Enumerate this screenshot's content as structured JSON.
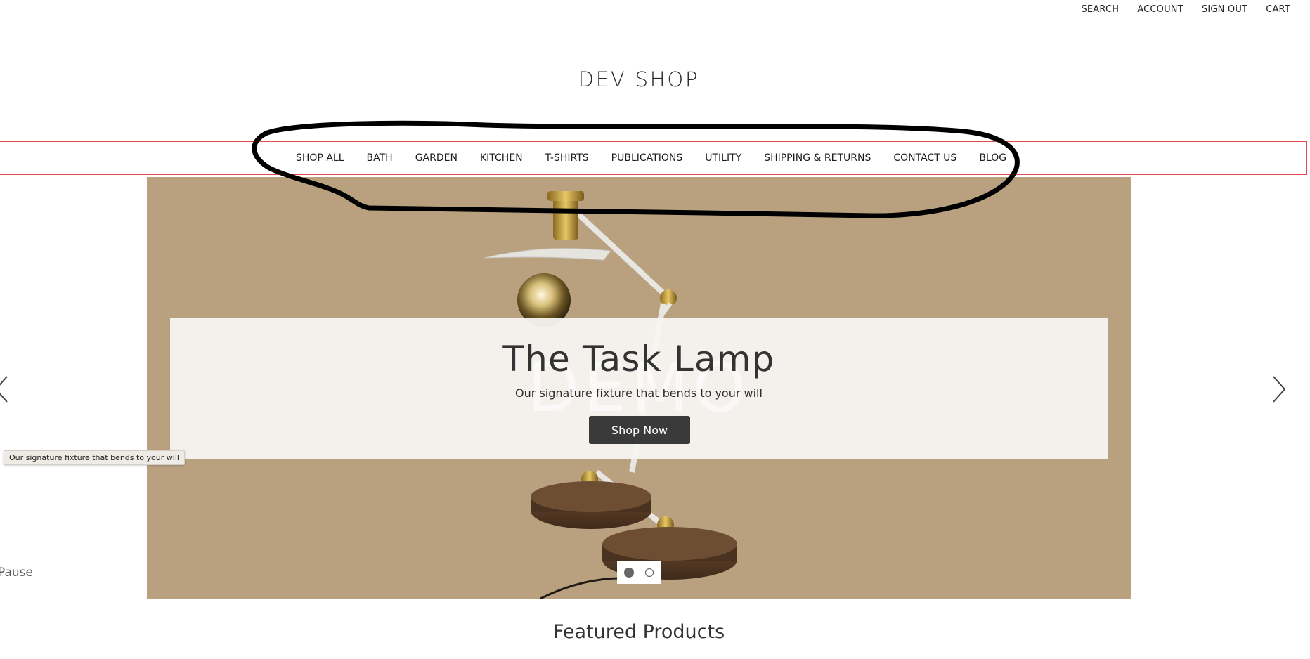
{
  "top_nav": {
    "search": "SEARCH",
    "account": "ACCOUNT",
    "sign_out": "SIGN OUT",
    "cart": "CART"
  },
  "store": {
    "name": "DEV SHOP"
  },
  "main_nav": {
    "items": [
      {
        "label": "SHOP ALL"
      },
      {
        "label": "BATH"
      },
      {
        "label": "GARDEN"
      },
      {
        "label": "KITCHEN"
      },
      {
        "label": "T-SHIRTS"
      },
      {
        "label": "PUBLICATIONS"
      },
      {
        "label": "UTILITY"
      },
      {
        "label": "SHIPPING & RETURNS"
      },
      {
        "label": "CONTACT US"
      },
      {
        "label": "BLOG"
      }
    ]
  },
  "hero": {
    "title": "The Task Lamp",
    "subtitle": "Our signature fixture that bends to your will",
    "button_label": "Shop Now",
    "watermark": "DEMO",
    "background_color": "#b9a180",
    "slide_count": 2,
    "active_slide": 1
  },
  "tooltip": {
    "text": "Our signature fixture that bends to your will"
  },
  "carousel": {
    "pause_label": "Pause",
    "prev_icon": "chevron-left-icon",
    "next_icon": "chevron-right-icon"
  },
  "featured": {
    "heading": "Featured Products"
  },
  "annotation": {
    "highlight_color": "#e34c4c",
    "marker_color": "#000000"
  }
}
